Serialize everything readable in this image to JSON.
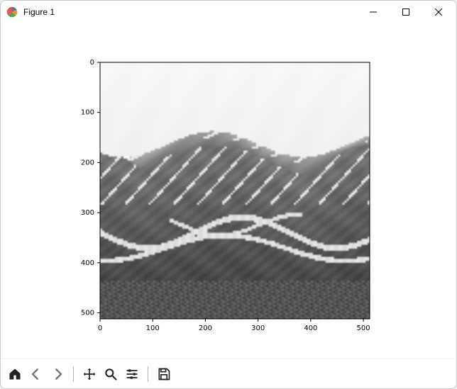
{
  "window": {
    "title": "Figure 1"
  },
  "chart_data": {
    "type": "image",
    "description": "Grayscale photographic image displayed via matplotlib imshow; default axes, no title or axis labels. Image depicts a valley landscape with hills, patches of snow, a braided river in the foreground, and overcast sky.",
    "image_shape": [
      512,
      512
    ],
    "colormap": "gray",
    "xlim": [
      0,
      512
    ],
    "ylim": [
      512,
      0
    ],
    "x_ticks": [
      0,
      100,
      200,
      300,
      400,
      500
    ],
    "y_ticks": [
      0,
      100,
      200,
      300,
      400,
      500
    ],
    "x_tick_labels": [
      "0",
      "100",
      "200",
      "300",
      "400",
      "500"
    ],
    "y_tick_labels": [
      "0",
      "100",
      "200",
      "300",
      "400",
      "500"
    ],
    "title": "",
    "xlabel": "",
    "ylabel": ""
  },
  "toolbar": {
    "home": "Home",
    "back": "Back",
    "forward": "Forward",
    "pan": "Pan",
    "zoom": "Zoom",
    "configure": "Configure subplots",
    "save": "Save the figure"
  },
  "icons": {
    "app": "matplotlib-icon",
    "minimize": "minimize-icon",
    "maximize": "maximize-icon",
    "close": "close-icon",
    "home": "home-icon",
    "back": "arrow-left-icon",
    "forward": "arrow-right-icon",
    "pan": "move-icon",
    "zoom": "magnify-icon",
    "configure": "sliders-icon",
    "save": "floppy-icon"
  }
}
